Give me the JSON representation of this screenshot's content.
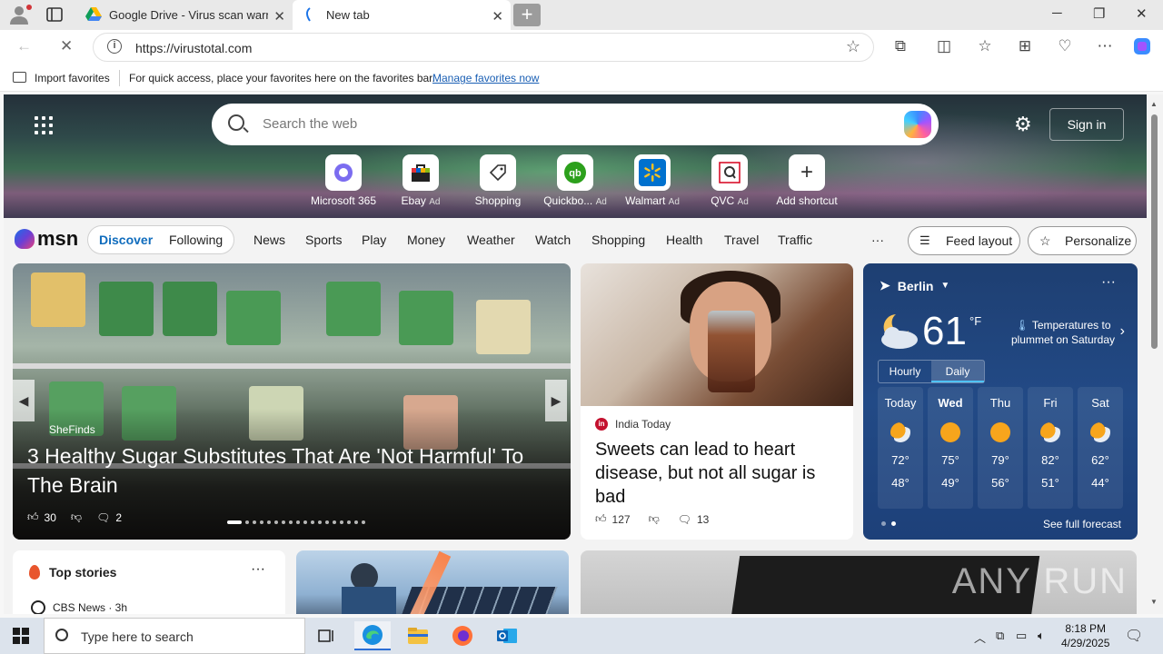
{
  "browser": {
    "tabs": [
      {
        "title": "Google Drive - Virus scan warning",
        "active": false
      },
      {
        "title": "New tab",
        "active": true
      }
    ],
    "new_tab_symbol": "+",
    "window_controls": [
      "─",
      "❐",
      "✕"
    ],
    "url": "https://virustotal.com",
    "favorites_bar": {
      "import_label": "Import favorites",
      "message": "For quick access, place your favorites here on the favorites bar.",
      "link": "Manage favorites now"
    }
  },
  "newtab": {
    "search_placeholder": "Search the web",
    "sign_in": "Sign in",
    "shortcuts": [
      {
        "label": "Microsoft 365",
        "ad": "",
        "icon": "m365-icon",
        "color": "#5b5fc7"
      },
      {
        "label": "Ebay",
        "ad": "Ad",
        "icon": "ebay-icon",
        "color": "#e53238"
      },
      {
        "label": "Shopping",
        "ad": "",
        "icon": "shopping-tag-icon",
        "color": "#333333"
      },
      {
        "label": "Quickbo...",
        "ad": "Ad",
        "icon": "quickbooks-icon",
        "color": "#2ca01c"
      },
      {
        "label": "Walmart",
        "ad": "Ad",
        "icon": "walmart-icon",
        "color": "#0071ce"
      },
      {
        "label": "QVC",
        "ad": "Ad",
        "icon": "qvc-icon",
        "color": "#d6001c"
      },
      {
        "label": "Add shortcut",
        "ad": "",
        "icon": "plus-icon",
        "color": "#333333"
      }
    ]
  },
  "msn": {
    "logo": "msn",
    "segments": {
      "discover": "Discover",
      "following": "Following"
    },
    "nav": [
      "News",
      "Sports",
      "Play",
      "Money",
      "Weather",
      "Watch",
      "Shopping",
      "Health",
      "Travel",
      "Traffic"
    ],
    "more": "···",
    "feed_layout": "Feed layout",
    "personalize": "Personalize"
  },
  "hero_card": {
    "source": "SheFinds",
    "title": "3 Healthy Sugar Substitutes That Are 'Not Harmful' To The Brain",
    "likes": "30",
    "comments": "2"
  },
  "story_card": {
    "source": "India Today",
    "title": "Sweets can lead to heart disease, but not all sugar is bad",
    "likes": "127",
    "comments": "13"
  },
  "weather": {
    "location": "Berlin",
    "temp": "61",
    "unit": "°F",
    "alert": "Temperatures to plummet on Saturday",
    "tabs": [
      "Hourly",
      "Daily"
    ],
    "days": [
      {
        "name": "Today",
        "hi": "72°",
        "lo": "48°",
        "icon": "partly-sunny-icon"
      },
      {
        "name": "Wed",
        "hi": "75°",
        "lo": "49°",
        "icon": "sunny-icon"
      },
      {
        "name": "Thu",
        "hi": "79°",
        "lo": "56°",
        "icon": "sunny-icon"
      },
      {
        "name": "Fri",
        "hi": "82°",
        "lo": "51°",
        "icon": "partly-sunny-icon"
      },
      {
        "name": "Sat",
        "hi": "62°",
        "lo": "44°",
        "icon": "partly-sunny-icon"
      }
    ],
    "see_full": "See full forecast"
  },
  "top_stories": {
    "title": "Top stories",
    "source": "CBS News · 3h"
  },
  "watermark": "ANY RUN",
  "taskbar": {
    "search_placeholder": "Type here to search",
    "time": "8:18 PM",
    "date": "4/29/2025"
  }
}
